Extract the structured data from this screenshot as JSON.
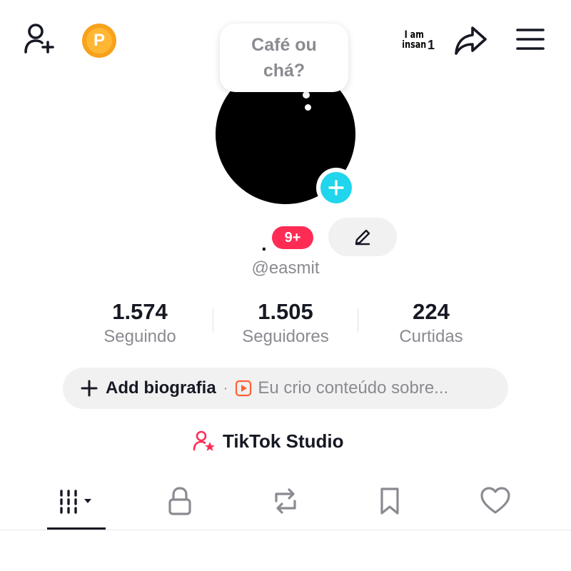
{
  "header": {
    "coin_letter": "P",
    "story_avatar_text": "I am\ninsan",
    "story_count": "1"
  },
  "profile": {
    "bubble_text": "Café ou chá?",
    "name": ".",
    "notification_badge": "9+",
    "handle": "@easmit"
  },
  "stats": [
    {
      "value": "1.574",
      "label": "Seguindo"
    },
    {
      "value": "1.505",
      "label": "Seguidores"
    },
    {
      "value": "224",
      "label": "Curtidas"
    }
  ],
  "bio": {
    "add_label": "Add biografia",
    "separator": "·",
    "suggestion": "Eu crio conteúdo sobre..."
  },
  "studio": {
    "label": "TikTok Studio"
  },
  "tabs": {
    "active": "videos",
    "items": [
      "videos",
      "private",
      "reposts",
      "saved",
      "liked"
    ]
  },
  "colors": {
    "accent": "#fe2c55",
    "add_button": "#20d5ec",
    "coin": "#f7a21b",
    "muted_text": "#8a8b91"
  },
  "icons": {
    "top_left": "add-friend-icon",
    "share": "share-arrow-icon",
    "menu": "hamburger-menu-icon",
    "edit": "pencil-icon",
    "bio_add": "plus-icon",
    "bio_suggestion": "play-square-icon",
    "studio": "user-star-icon"
  }
}
